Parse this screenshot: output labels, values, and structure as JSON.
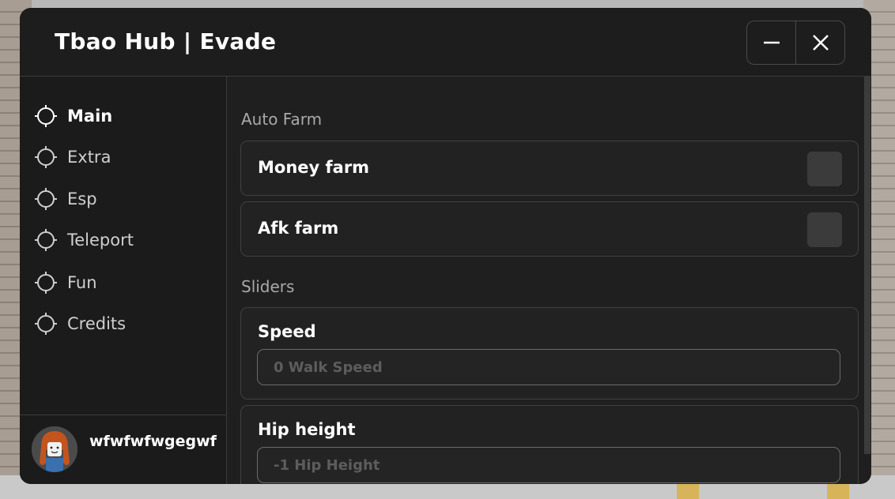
{
  "window": {
    "title": "Tbao Hub | Evade"
  },
  "controls": {
    "minimize": "—",
    "close": "✕"
  },
  "sidebar": {
    "items": [
      {
        "label": "Main",
        "icon": "crosshair-icon"
      },
      {
        "label": "Extra",
        "icon": "crosshair-icon"
      },
      {
        "label": "Esp",
        "icon": "crosshair-icon"
      },
      {
        "label": "Teleport",
        "icon": "crosshair-icon"
      },
      {
        "label": "Fun",
        "icon": "crosshair-icon"
      },
      {
        "label": "Credits",
        "icon": "crosshair-icon"
      }
    ],
    "active": "Main"
  },
  "profile": {
    "username": "wfwfwfwgegwf"
  },
  "main": {
    "auto_farm": {
      "header": "Auto Farm",
      "toggles": [
        {
          "label": "Money farm",
          "enabled": false
        },
        {
          "label": "Afk farm",
          "enabled": false
        }
      ]
    },
    "sliders": {
      "header": "Sliders",
      "inputs": [
        {
          "label": "Speed",
          "placeholder": "0 Walk Speed"
        },
        {
          "label": "Hip height",
          "placeholder": "-1 Hip Height"
        }
      ]
    }
  },
  "colors": {
    "panel": "#1f1f1f",
    "card": "#222222",
    "border": "#414141",
    "toggle": "#3b3b3b"
  }
}
